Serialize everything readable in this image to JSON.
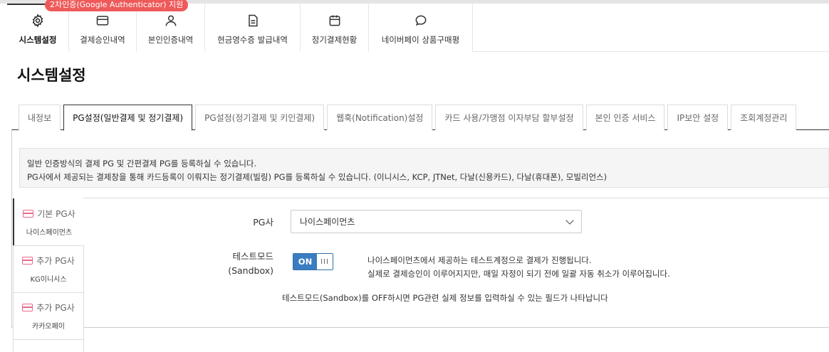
{
  "badge": "2차인증(Google Authenticator) 지원",
  "main_nav": [
    {
      "label": "시스템설정",
      "icon": "gear-icon"
    },
    {
      "label": "결제승인내역",
      "icon": "credit-card-icon"
    },
    {
      "label": "본인인증내역",
      "icon": "user-icon"
    },
    {
      "label": "현금영수증 발급내역",
      "icon": "document-icon"
    },
    {
      "label": "정기결제현황",
      "icon": "calendar-icon"
    },
    {
      "label": "네이버페이 상품구매평",
      "icon": "chat-bubble-icon"
    }
  ],
  "page_title": "시스템설정",
  "sub_tabs": [
    "내정보",
    "PG설정(일반결제 및 정기결제)",
    "PG설정(정기결제 및 키인결제)",
    "웹훅(Notification)설정",
    "카드 사용/가맹점 이자부담 할부설정",
    "본인 인증 서비스",
    "IP보안 설정",
    "조회계정관리"
  ],
  "notice": {
    "line1": "일반 인증방식의 결제 PG 및 간편결제 PG를 등록하실 수 있습니다.",
    "line2": "PG사에서 제공되는 결제창을 통해 카드등록이 이뤄지는 정기결제(빌링) PG를 등록하실 수 있습니다. (이니시스, KCP, JTNet, 다날(신용카드), 다날(휴대폰), 모빌리언스)"
  },
  "pg_tabs": [
    {
      "title": "기본 PG사",
      "name": "나이스페이먼츠"
    },
    {
      "title": "추가 PG사",
      "name": "KG이니시스"
    },
    {
      "title": "추가 PG사",
      "name": "카카오페이"
    }
  ],
  "form": {
    "pg_label": "PG사",
    "pg_value": "나이스페이먼츠",
    "test_label_1": "테스트모드",
    "test_label_2": "(Sandbox)",
    "toggle_on": "ON",
    "toggle_grip": "III",
    "desc_1": "나이스페이먼츠에서 제공하는 테스트계정으로 결제가 진행됩니다.",
    "desc_2": "실제로 결제승인이 이루어지지만, 매일 자정이 되기 전에 일괄 자동 취소가 이루어집니다.",
    "hint": "테스트모드(Sandbox)를 OFF하시면 PG관련 실제 정보를 입력하실 수 있는 필드가 나타납니다"
  },
  "colors": {
    "accent": "#3a7dc0",
    "badge": "#ee5a5a",
    "card_icon": "#e86a8a"
  }
}
